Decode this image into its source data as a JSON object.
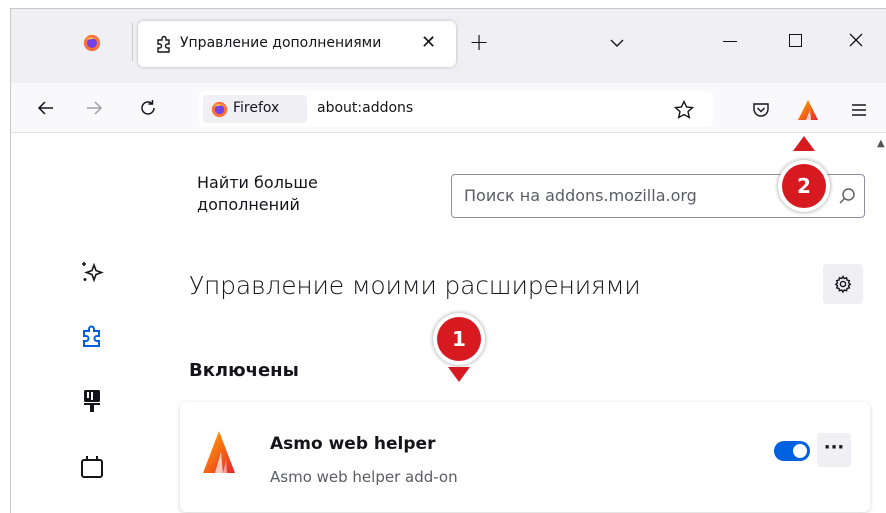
{
  "tab": {
    "title": "Управление дополнениями",
    "close": "✕"
  },
  "urlbar": {
    "identity_label": "Firefox",
    "url": "about:addons"
  },
  "content": {
    "find_more": "Найти больше дополнений",
    "search_placeholder": "Поиск на addons.mozilla.org",
    "heading": "Управление моими расширениями",
    "section_enabled": "Включены"
  },
  "extension": {
    "name": "Asmo web helper",
    "description": "Asmo web helper add-on",
    "enabled": true,
    "more": "···"
  },
  "callouts": {
    "one": "1",
    "two": "2",
    "color": "#d71920"
  },
  "colors": {
    "accent": "#0061e0",
    "tabstrip": "#f0f0f4"
  }
}
